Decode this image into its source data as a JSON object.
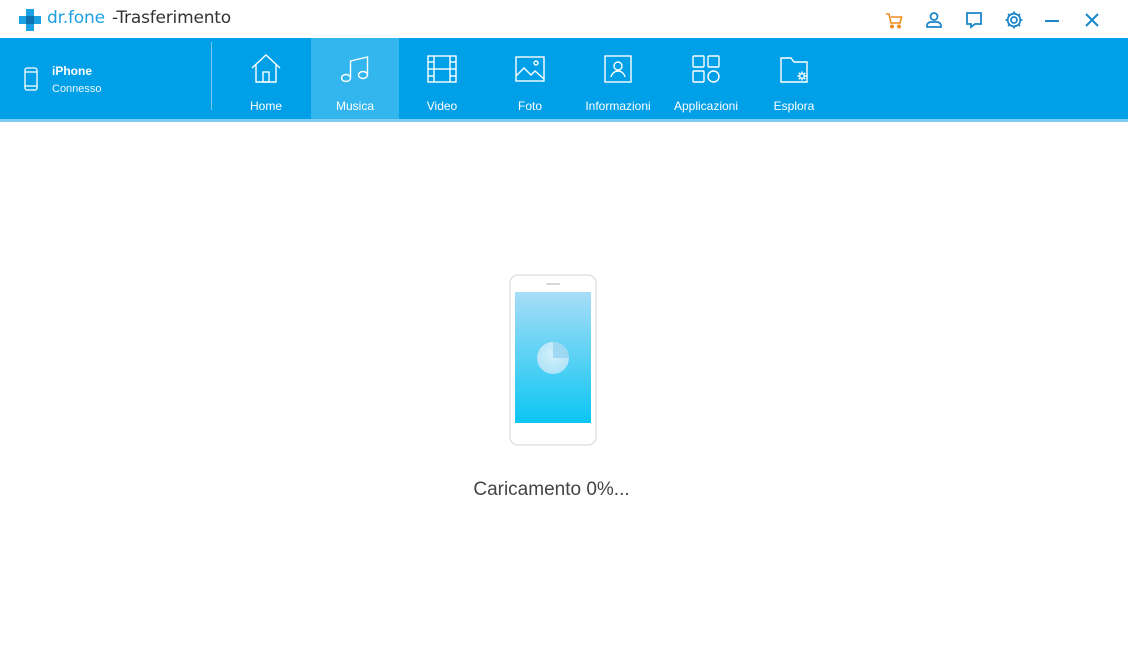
{
  "window": {
    "brand": "dr.fone",
    "subtitle": "-Trasferimento",
    "controls": [
      "cart-icon",
      "user-icon",
      "feedback-icon",
      "settings-icon",
      "minimize-icon",
      "close-icon"
    ]
  },
  "colors": {
    "accent": "#00a0e9",
    "active_tab": "#33b5ee",
    "cart": "#f08c1e",
    "control": "#1b86c9"
  },
  "device": {
    "name": "iPhone",
    "status": "Connesso"
  },
  "tabs": [
    {
      "label": "Home",
      "icon": "home-icon",
      "active": false
    },
    {
      "label": "Musica",
      "icon": "music-icon",
      "active": true
    },
    {
      "label": "Video",
      "icon": "video-icon",
      "active": false
    },
    {
      "label": "Foto",
      "icon": "photo-icon",
      "active": false
    },
    {
      "label": "Informazioni",
      "icon": "contacts-icon",
      "active": false
    },
    {
      "label": "Applicazioni",
      "icon": "apps-icon",
      "active": false
    },
    {
      "label": "Esplora",
      "icon": "explore-folder-icon",
      "active": false
    }
  ],
  "main": {
    "loading_text": "Caricamento 0%...",
    "progress_percent": 0
  }
}
